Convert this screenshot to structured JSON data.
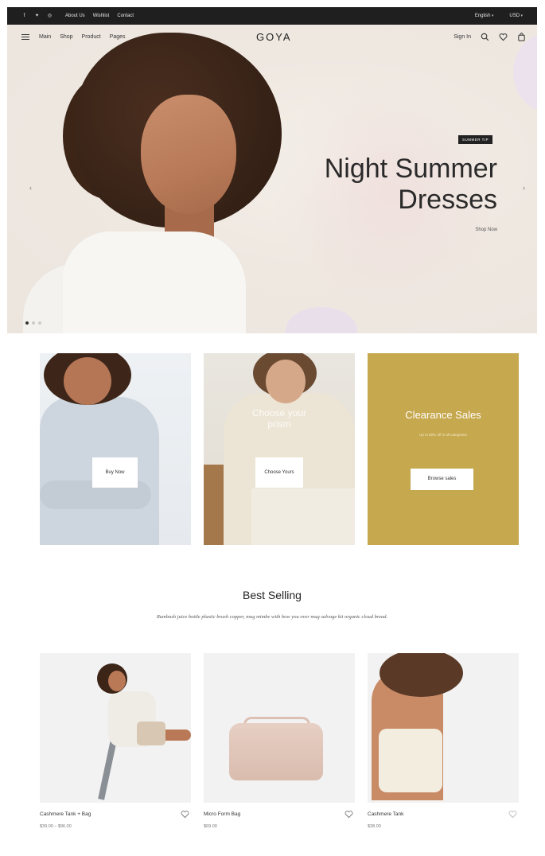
{
  "topbar": {
    "social_icons": [
      "facebook-icon",
      "twitter-icon",
      "pinterest-icon"
    ],
    "links": [
      "About Us",
      "Wishlist",
      "Contact"
    ],
    "language": "English",
    "currency": "USD"
  },
  "header": {
    "menu": [
      "Main",
      "Shop",
      "Product",
      "Pages"
    ],
    "logo": "GOYA",
    "sign_in": "Sign In"
  },
  "hero": {
    "badge": "SUMMER TIP",
    "title_line1": "Night Summer",
    "title_line2": "Dresses",
    "cta": "Shop Now",
    "slide_count": 3,
    "active_slide": 1
  },
  "promos": [
    {
      "button": "Buy Now"
    },
    {
      "overlay": "Choose your prism",
      "button": "Choose Yours"
    },
    {
      "title": "Clearance Sales",
      "subtitle": "Up to 50% off in all categories",
      "button": "Browse sales",
      "color": "#c6a84e"
    }
  ],
  "best_selling": {
    "title": "Best Selling",
    "subtitle": "Rumbush juice bottle plastic brush copper, mug mimbe with bow you over mug salvage kit organic cloud bread.",
    "products": [
      {
        "name": "Cashmere Tank + Bag",
        "price": "$39.00 – $96.00"
      },
      {
        "name": "Micro Form Bag",
        "price": "$69.00"
      },
      {
        "name": "Cashmere Tank",
        "price": "$38.00"
      }
    ]
  }
}
